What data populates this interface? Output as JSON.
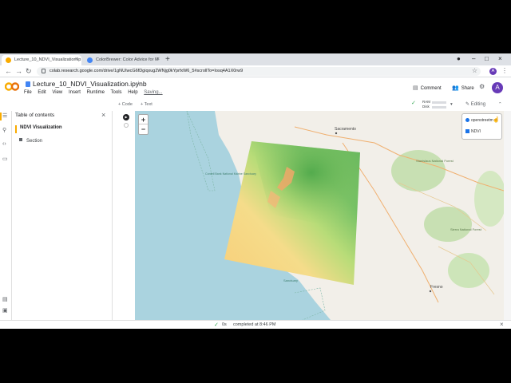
{
  "browser": {
    "tabs": [
      {
        "label": "Lecture_10_NDVI_Visualization.ip",
        "close": "×"
      },
      {
        "label": "ColorBrewer: Color Advice for M",
        "close": "×"
      }
    ],
    "new_tab": "+",
    "url": "colab.research.google.com/drive/1gNUIwcG6fDgiqxug2WNjg0kYprfxW6_5#scrollTo=Iosq4A1X0rw9",
    "profile_initial": "A",
    "nav_back": "←",
    "nav_forward": "→",
    "nav_reload": "↻",
    "bookmark_star": "☆",
    "menu": "⋮",
    "minimize": "–",
    "maximize": "□",
    "close_window": "×"
  },
  "colab": {
    "logo_text": "CO",
    "notebook_title": "Lecture_10_NDVI_Visualization.ipynb",
    "menu": [
      "File",
      "Edit",
      "View",
      "Insert",
      "Runtime",
      "Tools",
      "Help"
    ],
    "saving": "Saving...",
    "comment_label": "Comment",
    "share_label": "Share",
    "user_initial": "A",
    "toolbar": {
      "add_code": "+ Code",
      "add_text": "+ Text",
      "ram_label": "RAM",
      "disk_label": "Disk",
      "editing_label": "Editing"
    }
  },
  "toc": {
    "title": "Table of contents",
    "items": [
      {
        "label": "NDVI Visualization"
      },
      {
        "label": "Section"
      }
    ]
  },
  "map": {
    "zoom_in": "+",
    "zoom_out": "−",
    "layers": [
      {
        "label": "openstreetm",
        "type": "radio",
        "checked": true
      },
      {
        "label": "NDVI",
        "type": "checkbox",
        "checked": true
      }
    ],
    "place_labels": {
      "sacramento": "Sacramento",
      "stanislaus": "Stanislaus National Forest",
      "sierra": "Sierra National Forest",
      "fresno": "Fresno",
      "cordell": "Cordell Bank National Marine Sanctuary",
      "sanctuary": "Sanctuary"
    },
    "colors": {
      "ocean": "#aad3df",
      "land": "#f2efe9",
      "forest": "#c8e0b3",
      "ndvi_low": "#f7d58a",
      "ndvi_high": "#3a9a3a"
    }
  },
  "status": {
    "seconds": "0s",
    "text": "completed at 8:46 PM",
    "close": "×"
  }
}
